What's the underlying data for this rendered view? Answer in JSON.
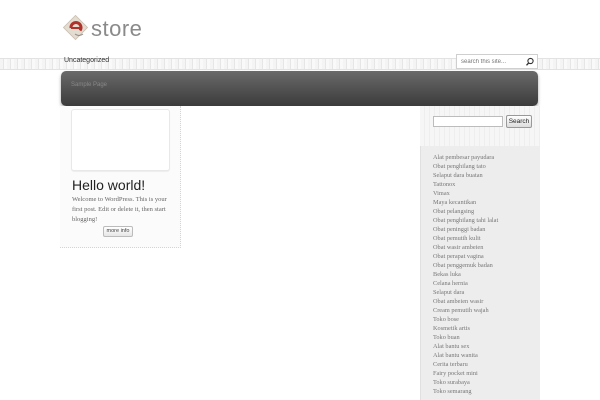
{
  "header": {
    "logo_text": "store",
    "nav_category": "Uncategorized"
  },
  "search_top": {
    "placeholder": "search this site..."
  },
  "darkbar": {
    "label": "Sample Page"
  },
  "post": {
    "title": "Hello world!",
    "excerpt": "Welcome to WordPress. This is your first post. Edit or delete it, then start blogging!",
    "more_label": "more info"
  },
  "sidebar": {
    "search_button": "Search",
    "links": [
      "Alat pembesar payudara",
      "Obat penghilang tato",
      "Selaput dara buatan",
      "Tattonox",
      "Vimax",
      "Maya kecantikan",
      "Obat pelangsing",
      "Obat penghilang tahi lalat",
      "Obat peninggi badan",
      "Obat pemutih kulit",
      "Obat wasir ambeien",
      "Obat perapat vagina",
      "Obat penggemuk badan",
      "Bekas luka",
      "Celana hernia",
      "Selaput dara",
      "Obat ambeien wasir",
      "Cream pemutih wajah",
      "Toko bose",
      "Kosmetik artis",
      "Toko buan",
      "Alat bantu sex",
      "Alat bantu wanita",
      "Cerita terbaru",
      "Fairy pocket mini",
      "Toko surabaya",
      "Toko semarang"
    ]
  },
  "colors": {
    "darkbar_top": "#6a6a6a",
    "darkbar_bottom": "#3b3b3b",
    "logo_red": "#b0322a",
    "sidebar_bg": "#ededed"
  }
}
